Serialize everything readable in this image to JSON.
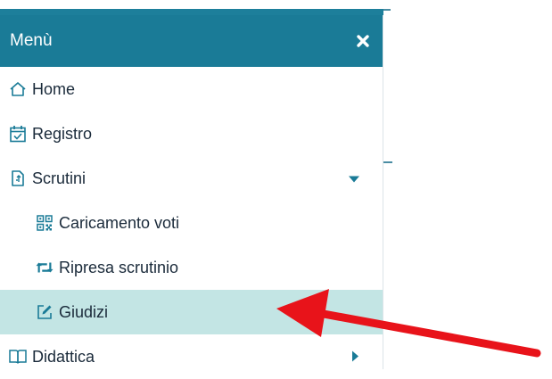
{
  "menu": {
    "title": "Menù",
    "items": [
      {
        "label": "Home",
        "icon": "home-icon"
      },
      {
        "label": "Registro",
        "icon": "calendar-check-icon"
      },
      {
        "label": "Scrutini",
        "icon": "document-icon",
        "expanded": true
      },
      {
        "label": "Caricamento voti",
        "icon": "qrcode-icon"
      },
      {
        "label": "Ripresa scrutinio",
        "icon": "retweet-icon"
      },
      {
        "label": "Giudizi",
        "icon": "edit-icon",
        "selected": true
      },
      {
        "label": "Didattica",
        "icon": "book-icon",
        "expanded": false
      }
    ]
  },
  "colors": {
    "header_bg": "#1a7b97",
    "selected_bg": "#c3e5e4",
    "icon": "#1a7b97",
    "arrow": "#e8131a"
  }
}
